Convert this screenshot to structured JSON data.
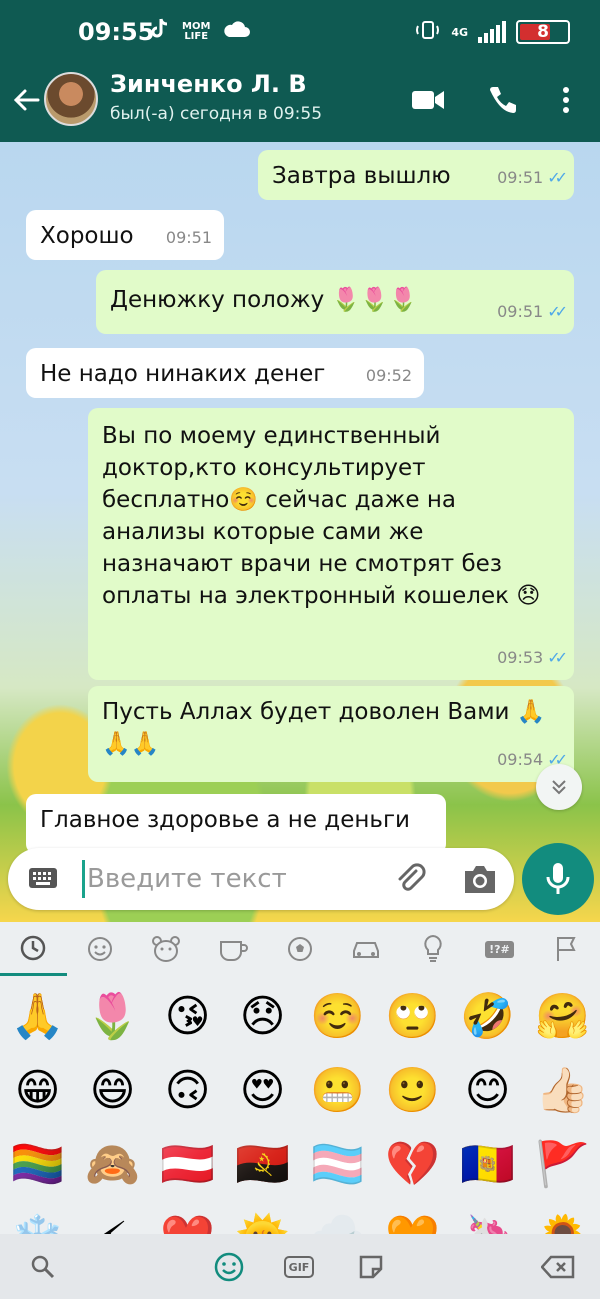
{
  "status_bar": {
    "time": "09:55",
    "network": "4G",
    "battery": "8",
    "app_badge": "MOM\nLIFE"
  },
  "header": {
    "back_icon": "arrow-left-icon",
    "contact_name": "Зинченко Л. В",
    "last_seen": "был(-а) сегодня в 09:55",
    "icons": [
      "video-call-icon",
      "phone-icon",
      "more-vert-icon"
    ]
  },
  "messages": [
    {
      "dir": "out",
      "text": "Завтра вышлю",
      "time": "09:51",
      "read": true
    },
    {
      "dir": "in",
      "text": "Хорошо",
      "time": "09:51"
    },
    {
      "dir": "out",
      "text": "Денюжку положу 🌷🌷🌷",
      "time": "09:51",
      "read": true
    },
    {
      "dir": "in",
      "text": "Не надо нинаких денег",
      "time": "09:52"
    },
    {
      "dir": "out",
      "text": "Вы по моему единственный доктор,кто консультирует бесплатно☺️ сейчас даже на анализы которые сами же назначают врачи не смотрят без оплаты на электронный кошелек 😞",
      "time": "09:53",
      "read": true
    },
    {
      "dir": "out",
      "text": "Пусть Аллах будет доволен Вами 🙏🙏🙏",
      "time": "09:54",
      "read": true
    },
    {
      "dir": "in",
      "text": "Главное здоровье а не деньги",
      "time": ""
    }
  ],
  "input": {
    "placeholder": "Введите текст"
  },
  "emoji_keyboard": {
    "categories": [
      "recent-clock-icon",
      "smiley-icon",
      "animal-icon",
      "food-cup-icon",
      "ball-icon",
      "car-icon",
      "lightbulb-icon",
      "symbols-icon",
      "flag-icon"
    ],
    "symbols_label": "!?#",
    "emojis": [
      "🙏",
      "🌷",
      "😘",
      "😞",
      "☺️",
      "🙄",
      "🤣",
      "🤗",
      "😁",
      "😄",
      "🙃",
      "😍",
      "😬",
      "🙂",
      "😊",
      "👍🏻",
      "🏳️‍🌈",
      "🙈",
      "🇦🇹",
      "🇦🇴",
      "🏳️‍⚧️",
      "💔",
      "🇦🇩",
      "🚩",
      "❄️",
      "⚡",
      "❤️",
      "🌞",
      "🌨️",
      "🧡",
      "🦄",
      "🌻"
    ],
    "bottom": {
      "gif_label": "GIF"
    }
  }
}
